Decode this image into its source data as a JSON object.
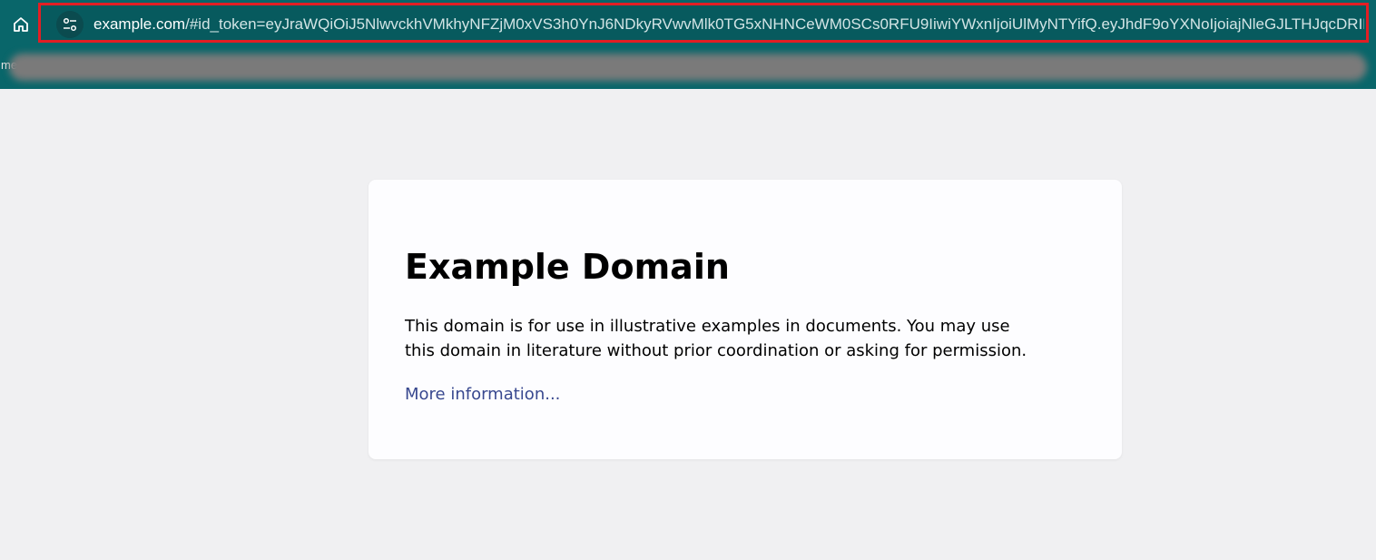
{
  "browser": {
    "home_icon": "home-icon",
    "site_settings_icon": "tune-icon",
    "url_host": "example.com",
    "url_rest": "/#id_token=eyJraWQiOiJ5NlwvckhVMkhyNFZjM0xVS3h0YnJ6NDkyRVwvMlk0TG5xNHNCeWM0SCs0RFU9IiwiYWxnIjoiUlMyNTYifQ.eyJhdF9oYXNoIjoiajNleGJLTHJqcDRIN...",
    "bookmark_peek": "me",
    "accent_color": "#09666a",
    "highlight_color": "#e31e24"
  },
  "page": {
    "title": "Example Domain",
    "body": "This domain is for use in illustrative examples in documents. You may use this domain in literature without prior coordination or asking for permission.",
    "link_text": "More information...",
    "link_color": "#38488f"
  }
}
